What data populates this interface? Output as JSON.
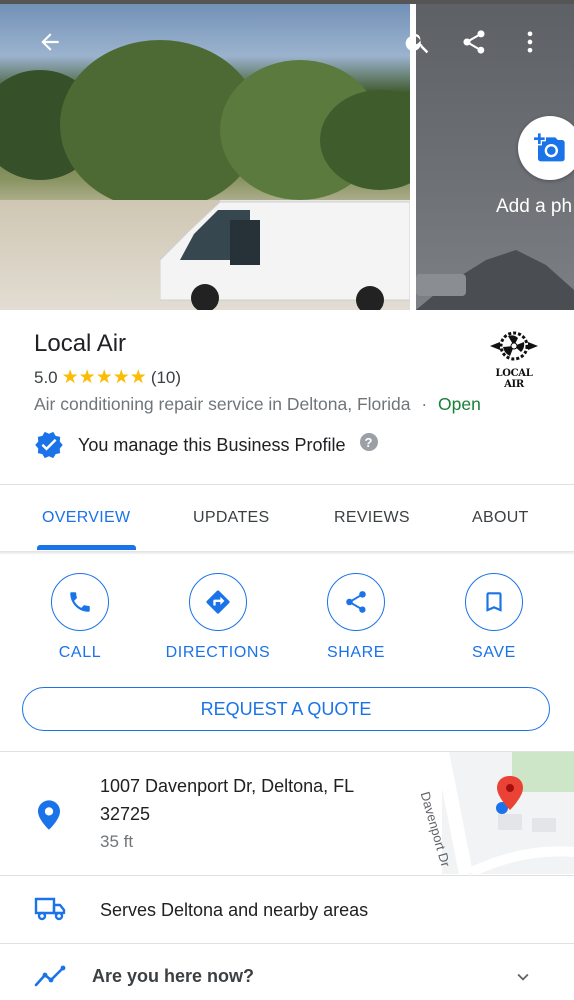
{
  "header": {
    "back_icon": "arrow-left-icon",
    "search_icon": "search-icon",
    "share_icon": "share-icon",
    "more_icon": "more-vert-icon",
    "add_photo_label": "Add a ph"
  },
  "business": {
    "name": "Local Air",
    "rating": "5.0",
    "stars": "★★★★★",
    "review_count": "(10)",
    "category": "Air conditioning repair service in Deltona, Florida",
    "separator": "·",
    "status": "Open",
    "logo_text": "LOCAL AIR",
    "manage_text": "You manage this Business Profile",
    "help_glyph": "?"
  },
  "tabs": [
    {
      "label": "OVERVIEW",
      "active": true
    },
    {
      "label": "UPDATES",
      "active": false
    },
    {
      "label": "REVIEWS",
      "active": false
    },
    {
      "label": "ABOUT",
      "active": false
    }
  ],
  "actions": [
    {
      "label": "CALL",
      "icon": "phone-icon"
    },
    {
      "label": "DIRECTIONS",
      "icon": "directions-icon"
    },
    {
      "label": "SHARE",
      "icon": "share-icon"
    },
    {
      "label": "SAVE",
      "icon": "bookmark-icon"
    }
  ],
  "quote_button": "REQUEST A QUOTE",
  "address": {
    "line1": "1007 Davenport Dr, Deltona, FL",
    "line2": "32725",
    "distance": "35 ft",
    "map_street_label": "Davenport Dr"
  },
  "serves": "Serves Deltona and nearby areas",
  "here_now": "Are you here now?",
  "colors": {
    "accent": "#1a73e8",
    "open": "#188038",
    "star": "#fbbc04",
    "pin": "#ea4335"
  }
}
